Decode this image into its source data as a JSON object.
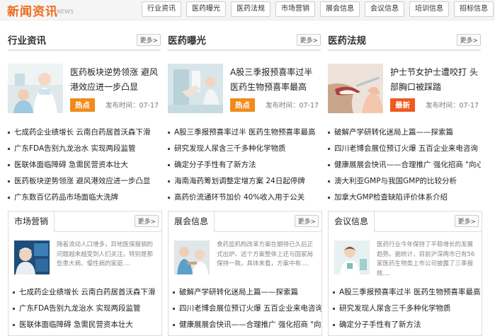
{
  "header": {
    "brand": "新闻资讯",
    "brand_sub": "NEWS",
    "tabs": [
      "行业资讯",
      "医药曝光",
      "医药法规",
      "市场营销",
      "展会信息",
      "会议信息",
      "培训信息",
      "招标信息"
    ]
  },
  "more_label": "更多>",
  "columns": [
    {
      "title": "行业资讯",
      "feature": {
        "title": "医药板块逆势领涨 避风港效应进一步凸显",
        "badge": "热点",
        "badge_color": "#f08a1c",
        "pubtime": "发布时间：07-17"
      },
      "items": [
        "七成药企业绩增长 云南白药居首沃森下滑",
        "广东FDA告别九龙治水 实现两段监管",
        "医联体面临障碍 急需民营资本壮大",
        "医药板块逆势领涨 避风港效应进一步凸显",
        "广东数百亿药品市场面临大洗牌"
      ]
    },
    {
      "title": "医药曝光",
      "feature": {
        "title": "A股三季报预喜率过半 医药生物预喜率最高",
        "badge": "热点",
        "badge_color": "#f08a1c",
        "pubtime": "发布时间：07-17"
      },
      "items": [
        "A股三季报预喜率过半 医药生物预喜率最高",
        "研究发现人尿含三千多种化学物质",
        "确定分子手性有了新方法",
        "海南海药筹划调整定增方案 24日起停牌",
        "高药价流通环节加价 40%收入用于公关"
      ]
    },
    {
      "title": "医药法规",
      "feature": {
        "title": "护士节女护士遭咬打 头部胸口被踩踏",
        "badge": "最新",
        "badge_color": "#ee5a1e",
        "pubtime": "发布时间：07-17"
      },
      "items": [
        "破解产学研转化迷局上篇——探索篇",
        "四川老博会展位预订火爆 五百企业来电咨询",
        "健康展展会快讯——合理推广 强化招商 \"向心力",
        "澳大利亚GMP与我国GMP的比较分析",
        "加拿大GMP检查缺陷评价体系介绍"
      ]
    }
  ],
  "boxes": [
    {
      "title": "市场营销",
      "text": "随着流动人口增多，异地医保报销的问题越来越受到人们关注。特别是那些患大病、慢性病的家庭....",
      "items": [
        "七成药企业绩增长 云南白药居首沃森下滑",
        "广东FDA告别九龙治水 实现两段监管",
        "医联体面临障碍 急需民营资本壮大"
      ]
    },
    {
      "title": "展会信息",
      "text": "食药监机构改革方案在期待已久后正式出炉。这个方案整体上还与国家局保持一致。具体来看，方案中有....",
      "items": [
        "破解产学研转化迷局上篇——探索篇",
        "四川老博会展位预订火爆 五百企业来电咨询",
        "健康展展会快讯——合理推广 强化招商 \"向心力"
      ]
    },
    {
      "title": "会议信息",
      "text": "医药行业今年保持了平稳增长的发展趋势。据统计，目前沪深两市已有56家医药生物类上市公司披露了三季报核....",
      "items": [
        "A股三季报预喜率过半 医药生物预喜率最高",
        "研究发现人尿含三千多种化学物质",
        "确定分子手性有了新方法"
      ]
    }
  ]
}
